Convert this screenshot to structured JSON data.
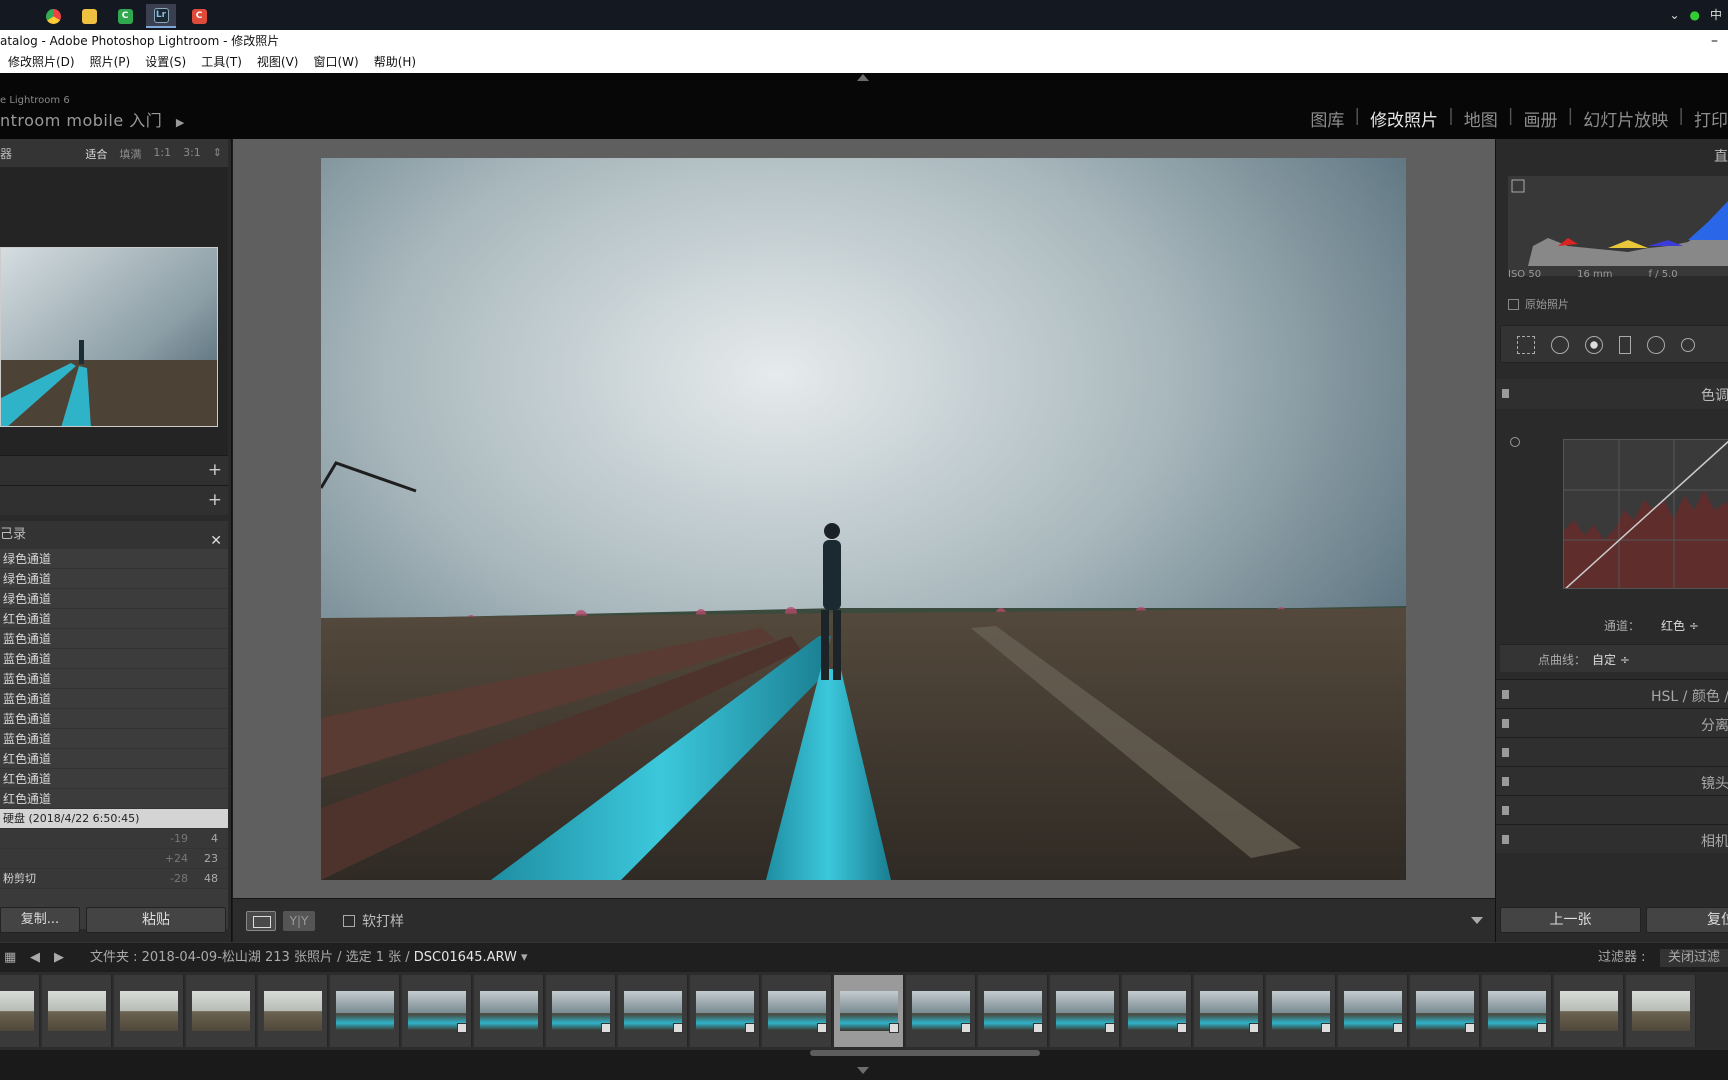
{
  "window": {
    "title": "atalog - Adobe Photoshop Lightroom - 修改照片",
    "minimize": "–"
  },
  "taskbar": {
    "ime": "中"
  },
  "menu": [
    "修改照片(D)",
    "照片(P)",
    "设置(S)",
    "工具(T)",
    "视图(V)",
    "窗口(W)",
    "帮助(H)"
  ],
  "header": {
    "brand_small": "e Lightroom 6",
    "brand_big": "ntroom mobile 入门",
    "play": "▶",
    "modules": [
      {
        "label": "图库",
        "active": false
      },
      {
        "label": "修改照片",
        "active": true
      },
      {
        "label": "地图",
        "active": false
      },
      {
        "label": "画册",
        "active": false
      },
      {
        "label": "幻灯片放映",
        "active": false
      },
      {
        "label": "打印",
        "active": false
      }
    ]
  },
  "left": {
    "navigator_title": "器",
    "zoom": {
      "fit": "适合",
      "fill": "填满",
      "z1": "1:1",
      "z3": "3:1"
    },
    "history_title": "己录",
    "history": [
      "绿色通道",
      "绿色通道",
      "绿色通道",
      "红色通道",
      "蓝色通道",
      "蓝色通道",
      "蓝色通道",
      "蓝色通道",
      "蓝色通道",
      "蓝色通道",
      "红色通道",
      "红色通道",
      "红色通道"
    ],
    "snapshot": "硬盘 (2018/4/22 6:50:45)",
    "num_rows": [
      {
        "label": "",
        "a": "-19",
        "b": "4"
      },
      {
        "label": "",
        "a": "+24",
        "b": "23"
      },
      {
        "label": "粉剪切",
        "a": "-28",
        "b": "48"
      }
    ],
    "copy_label": "复制...",
    "paste_label": "粘贴"
  },
  "toolbar": {
    "yy_label": "Y|Y",
    "soft_proof": "软打样"
  },
  "right": {
    "histogram_title": "直",
    "exif": {
      "iso": "ISO 50",
      "focal": "16 mm",
      "aperture": "f / 5.0"
    },
    "original_photo": "原始照片",
    "tone_curve_title": "色调",
    "channel_label": "通道：",
    "channel_value": "红色 ÷",
    "point_curve_label": "点曲线：",
    "point_curve_value": "自定 ÷",
    "panels": [
      "HSL  /  颜色  /",
      "分离",
      "",
      "镜头",
      "",
      "相机"
    ],
    "prev_label": "上一张",
    "reset_label": "复位"
  },
  "filmstrip": {
    "path_prefix": "文件夹 : 2018-04-09-松山湖   213 张照片 / 选定 1 张 / ",
    "filename": "DSC01645.ARW",
    "filter_label": "过滤器 :",
    "filter_value": "关闭过滤"
  },
  "colors": {
    "accent_active": "#e6e6e6",
    "panel_bg": "#2a2a2a",
    "photo_teal": "#2fb3c9"
  }
}
